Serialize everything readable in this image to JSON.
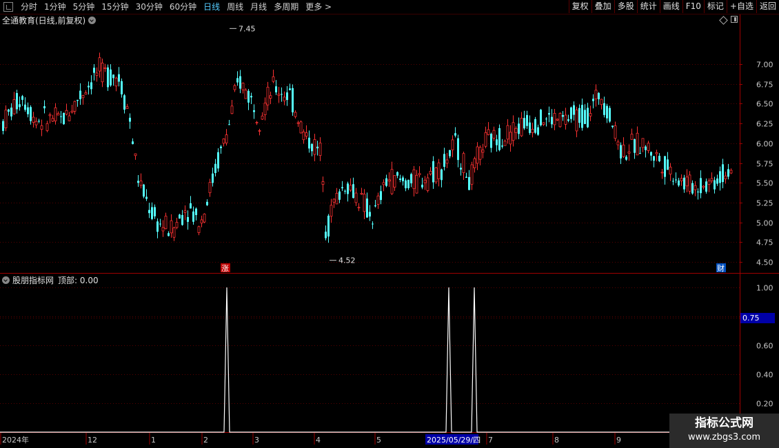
{
  "toolbar": {
    "periods": [
      "分时",
      "1分钟",
      "5分钟",
      "15分钟",
      "30分钟",
      "60分钟",
      "日线",
      "周线",
      "月线",
      "多周期",
      "更多 >"
    ],
    "active_period": "日线",
    "right_buttons": [
      "复权",
      "叠加",
      "多股",
      "统计",
      "画线",
      "F10",
      "标记",
      "+自选",
      "返回"
    ]
  },
  "main_chart": {
    "title": "全通教育(日线,前复权)",
    "y_ticks": [
      "7.00",
      "6.75",
      "6.50",
      "6.25",
      "6.00",
      "5.75",
      "5.50",
      "5.25",
      "5.00",
      "4.75",
      "4.50"
    ],
    "y_values": [
      7.0,
      6.75,
      6.5,
      6.25,
      6.0,
      5.75,
      5.5,
      5.25,
      5.0,
      4.75,
      4.5
    ],
    "ylim": [
      4.4,
      7.8
    ],
    "high_label": "7.45",
    "low_label": "4.52",
    "marker_zhang": "涨",
    "marker_cai": "财",
    "up_color": "#ff3232",
    "down_color": "#54ffff"
  },
  "sub_chart": {
    "title": "股朋指标网",
    "value_label": "顶部: 0.00",
    "y_ticks": [
      "1.00",
      "0.80",
      "0.60",
      "0.40",
      "0.20"
    ],
    "y_values": [
      1.0,
      0.8,
      0.6,
      0.4,
      0.2
    ],
    "crosshair_value": "0.75",
    "line_color": "#ffffff"
  },
  "x_axis": {
    "labels": [
      "2024年",
      "12",
      "1",
      "2",
      "3",
      "4",
      "5",
      "7",
      "8",
      "9"
    ],
    "cursor_date": "2025/05/29/四"
  },
  "watermark": {
    "title": "指标公式网",
    "url": "www.zbgs3.com"
  },
  "chart_data": {
    "type": "candlestick",
    "price_axis_ticks": [
      7.0,
      6.75,
      6.5,
      6.25,
      6.0,
      5.75,
      5.5,
      5.25,
      5.0,
      4.75,
      4.5
    ],
    "period_high": 7.45,
    "period_low": 4.52,
    "indicator": {
      "name": "股朋指标网",
      "series": "顶部",
      "current_value": 0.0,
      "spike_value": 1.0,
      "spike_count": 3
    }
  }
}
